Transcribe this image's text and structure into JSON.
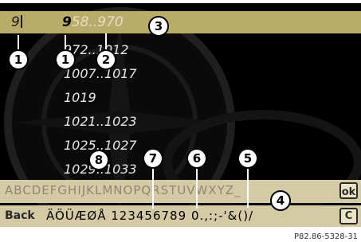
{
  "input": {
    "typed": "9",
    "match_typed": "9",
    "match_rest": "58..970"
  },
  "list_items": [
    "972..1012",
    "1007..1017",
    "1019",
    "1021..1023",
    "1025..1027",
    "1029..1033"
  ],
  "keyboard": {
    "row1_inactive_a": "ABCDEFGHIJKLMNOPQRSTUVWXYZ_",
    "ok_label": "ok",
    "back_label": "Back",
    "row2_inactive": "ÄÖÜÆØÅ",
    "row2_active_a": "12345",
    "row2_selected": "6",
    "row2_active_b": "789",
    "row2_inactive_b": "0.,:;-'&()/",
    "clear_label": "C"
  },
  "callouts": {
    "c1a": "1",
    "c1b": "1",
    "c2": "2",
    "c3": "3",
    "c4": "4",
    "c5": "5",
    "c6": "6",
    "c7": "7",
    "c8": "8"
  },
  "caption": "P82.86-5328-31"
}
